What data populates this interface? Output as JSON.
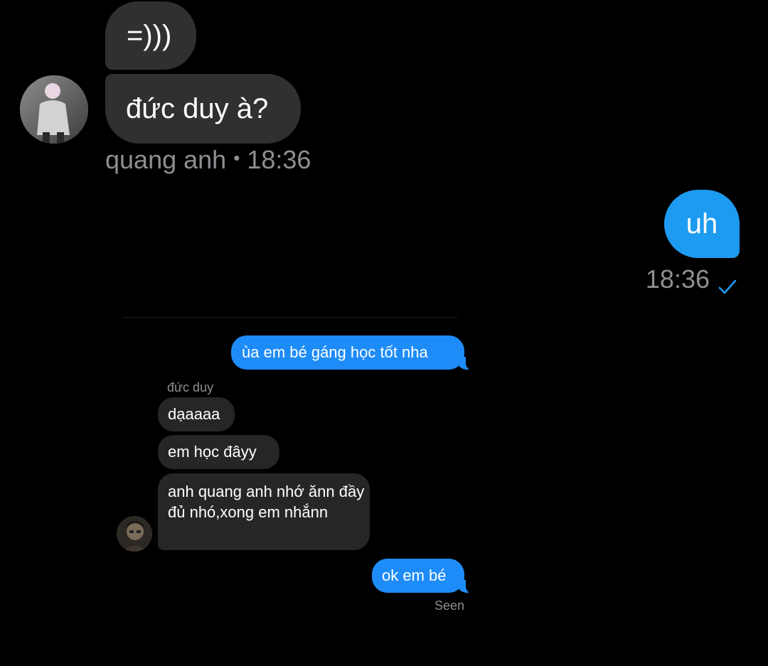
{
  "top_chat": {
    "received": [
      {
        "text": "=)))"
      },
      {
        "text": "đức duy à?"
      }
    ],
    "received_meta": {
      "sender": "quang anh",
      "separator": "•",
      "time": "18:36"
    },
    "sent": {
      "text": "uh"
    },
    "sent_meta": {
      "time": "18:36"
    }
  },
  "inner_chat": {
    "sent_1": "ùa em bé gáng học tốt nha",
    "sender_name": "đức duy",
    "received": [
      "dạaaaa",
      "em học đâyy",
      "anh quang anh nhớ ănn đầy đủ nhó,xong em nhắnn"
    ],
    "sent_2": "ok em bé",
    "status": "Seen"
  },
  "colors": {
    "background": "#000000",
    "sent_bubble_large": "#1d9bf0",
    "sent_bubble_small": "#1e8cf8",
    "received_bubble_large": "#2f3032",
    "received_bubble_small": "#262628",
    "meta_text": "#8e8f93"
  },
  "icons": {
    "read_receipt": "check-icon"
  }
}
